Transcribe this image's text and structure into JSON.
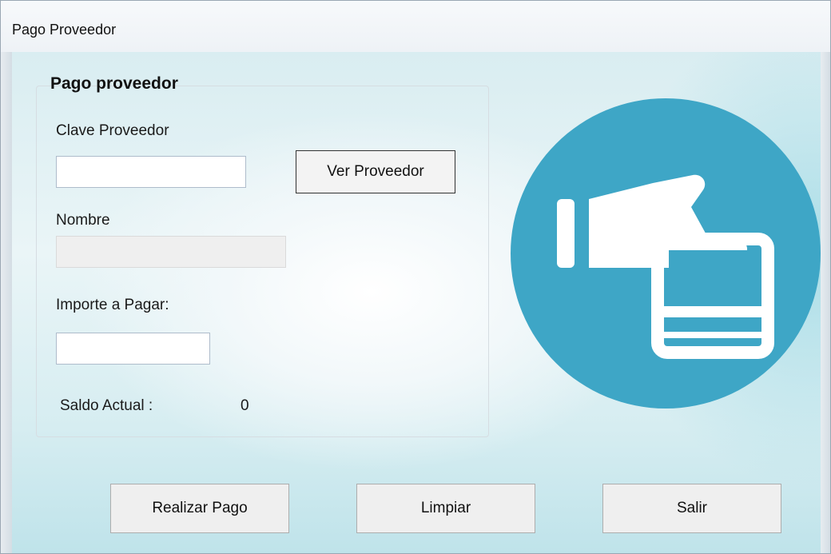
{
  "window": {
    "title": "Pago Proveedor"
  },
  "group": {
    "title": "Pago proveedor",
    "clave_label": "Clave Proveedor",
    "clave_value": "",
    "ver_button": "Ver Proveedor",
    "nombre_label": "Nombre",
    "nombre_value": "",
    "importe_label": "Importe a Pagar:",
    "importe_value": "",
    "saldo_label": "Saldo Actual :",
    "saldo_value": "0"
  },
  "icon": {
    "name": "hand-card-payment-icon",
    "circle_color": "#3ea6c6",
    "glyph_color": "#ffffff"
  },
  "footer": {
    "realizar_label": "Realizar Pago",
    "limpiar_label": "Limpiar",
    "salir_label": "Salir"
  }
}
